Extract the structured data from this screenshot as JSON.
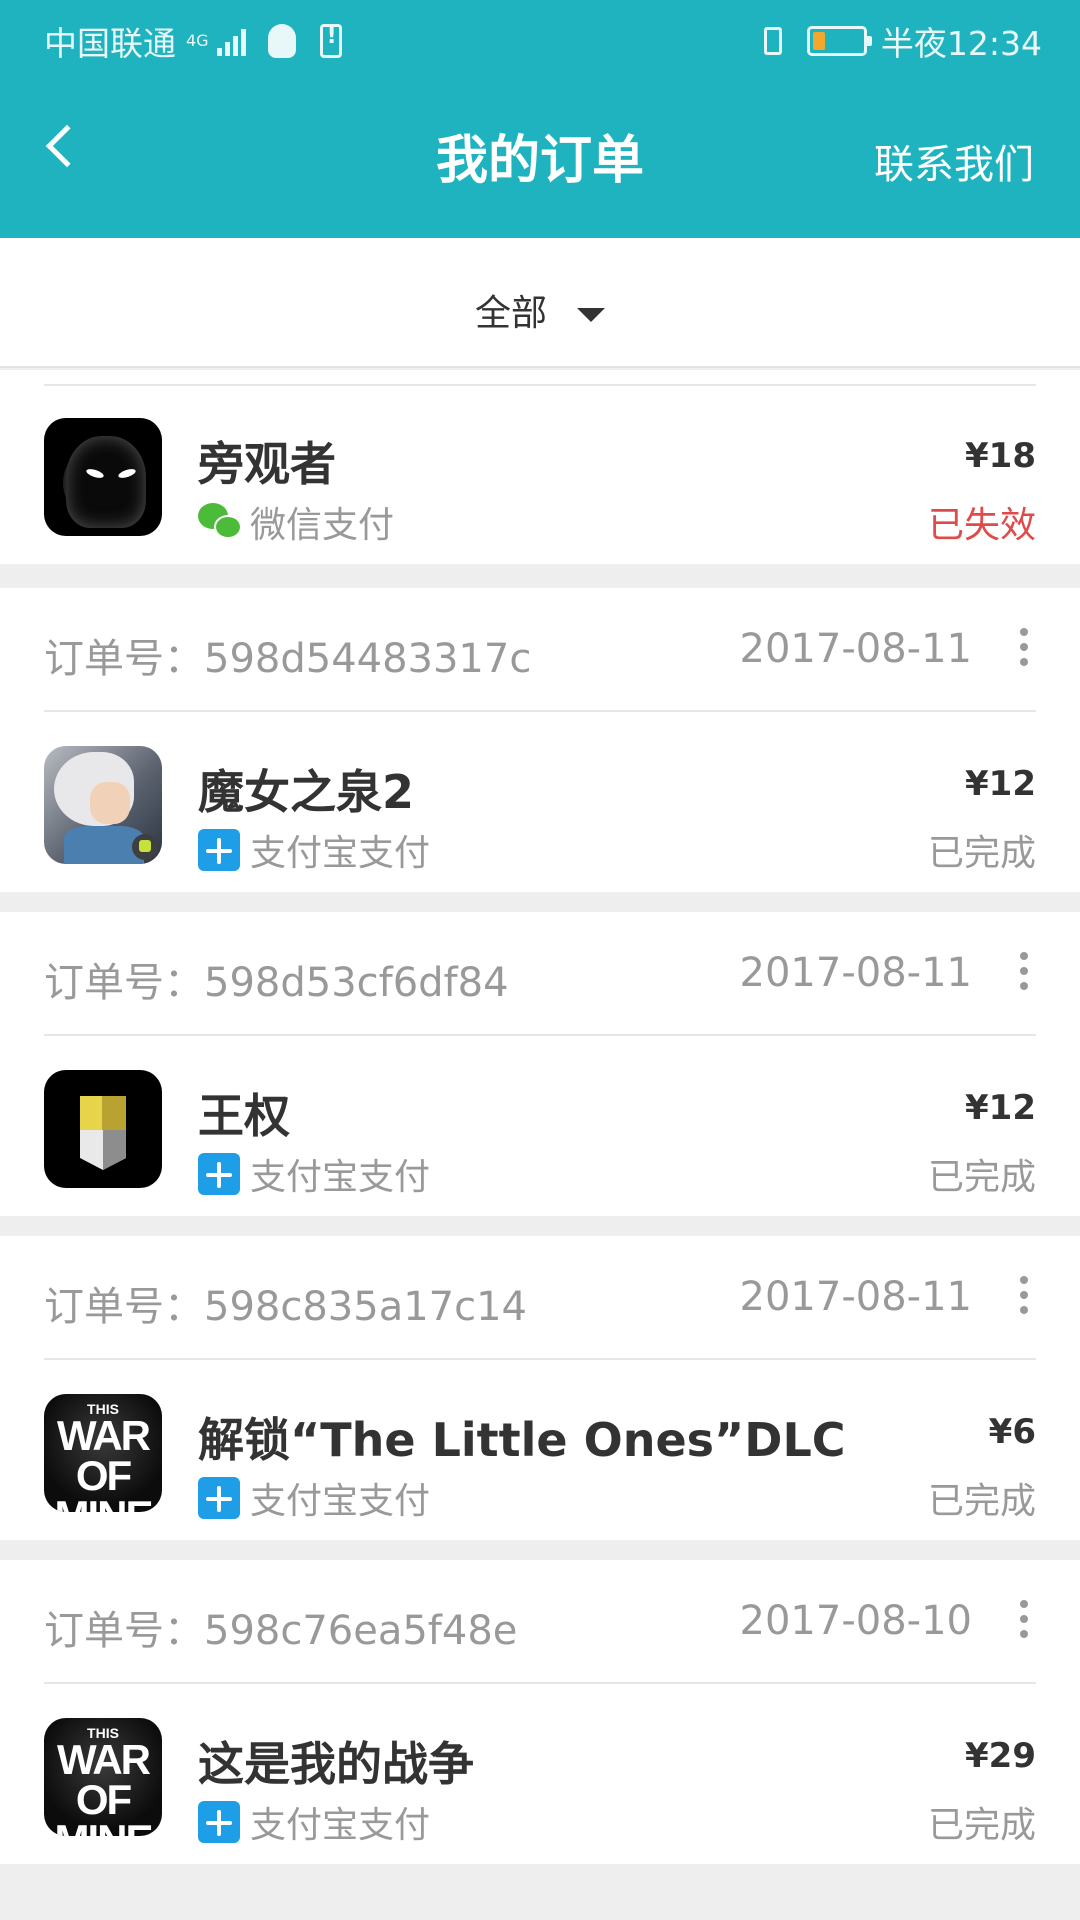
{
  "statusbar": {
    "carrier": "中国联通",
    "network": "4G",
    "time": "半夜12:34"
  },
  "header": {
    "title": "我的订单",
    "contact_label": "联系我们"
  },
  "filter": {
    "selected": "全部"
  },
  "colors": {
    "accent": "#1fb3c0",
    "invalid_status": "#e04a4a",
    "alipay": "#1e9ee6",
    "wechat": "#4cbb39"
  },
  "orders": [
    {
      "app_name": "旁观者",
      "pay_method": "微信支付",
      "pay_icon": "wechat-pay-icon",
      "price": "¥18",
      "status": "已失效"
    },
    {
      "order_label": "订单号：",
      "order_no": "598d54483317c",
      "date": "2017-08-11",
      "app_name": "魔女之泉2",
      "pay_method": "支付宝支付",
      "pay_icon": "alipay-icon",
      "price": "¥12",
      "status": "已完成"
    },
    {
      "order_label": "订单号：",
      "order_no": "598d53cf6df84",
      "date": "2017-08-11",
      "app_name": "王权",
      "pay_method": "支付宝支付",
      "pay_icon": "alipay-icon",
      "price": "¥12",
      "status": "已完成"
    },
    {
      "order_label": "订单号：",
      "order_no": "598c835a17c14",
      "date": "2017-08-11",
      "app_name": "解锁“The Little Ones”DLC",
      "pay_method": "支付宝支付",
      "pay_icon": "alipay-icon",
      "price": "¥6",
      "status": "已完成"
    },
    {
      "order_label": "订单号：",
      "order_no": "598c76ea5f48e",
      "date": "2017-08-10",
      "app_name": "这是我的战争",
      "pay_method": "支付宝支付",
      "pay_icon": "alipay-icon",
      "price": "¥29",
      "status": "已完成"
    }
  ],
  "war_icon_text": [
    "THIS",
    "WAR",
    "OF MINE"
  ]
}
